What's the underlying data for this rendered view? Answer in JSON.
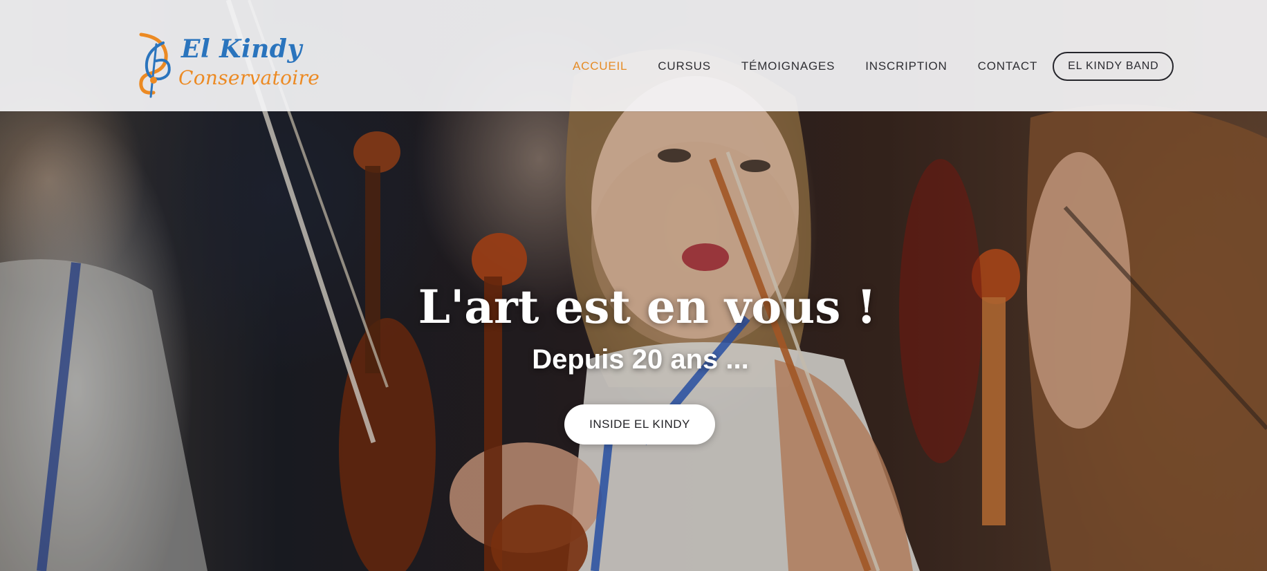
{
  "brand": {
    "logo_line1": "El Kindy",
    "logo_line2": "Conservatoire",
    "logo_icon": "treble-clef-icon",
    "color_blue": "#2a74bd",
    "color_orange": "#ec8a23"
  },
  "nav": {
    "items": [
      {
        "label": "ACCUEIL",
        "active": true
      },
      {
        "label": "CURSUS",
        "active": false
      },
      {
        "label": "TÉMOIGNAGES",
        "active": false
      },
      {
        "label": "INSCRIPTION",
        "active": false
      },
      {
        "label": "CONTACT",
        "active": false
      }
    ],
    "cta_label": "EL KINDY BAND",
    "active_color": "#e58b25"
  },
  "hero": {
    "title": "L'art est en vous !",
    "subtitle": "Depuis 20 ans ...",
    "button_label": "INSIDE EL KINDY",
    "background": "photo of young violinists performing"
  }
}
